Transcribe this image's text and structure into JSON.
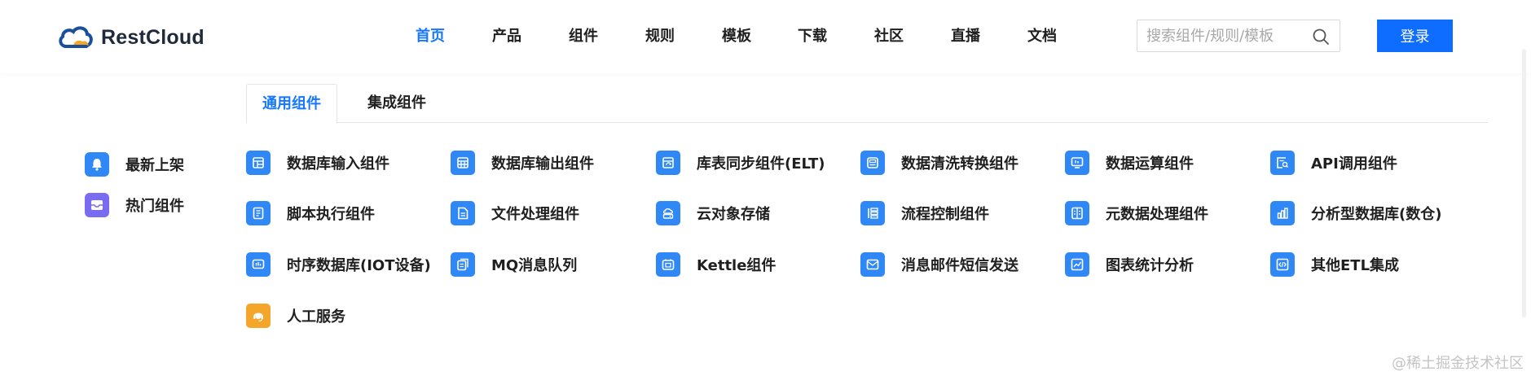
{
  "brand": {
    "name": "RestCloud"
  },
  "nav": {
    "items": [
      {
        "label": "首页",
        "active": true
      },
      {
        "label": "产品"
      },
      {
        "label": "组件"
      },
      {
        "label": "规则"
      },
      {
        "label": "模板"
      },
      {
        "label": "下载"
      },
      {
        "label": "社区"
      },
      {
        "label": "直播"
      },
      {
        "label": "文档"
      }
    ]
  },
  "search": {
    "placeholder": "搜索组件/规则/模板",
    "value": ""
  },
  "login": {
    "label": "登录"
  },
  "tabs": [
    {
      "label": "通用组件",
      "active": true
    },
    {
      "label": "集成组件"
    }
  ],
  "sidebar": {
    "items": [
      {
        "label": "最新上架",
        "icon": "bell-icon",
        "color": "#2f88f5"
      },
      {
        "label": "热门组件",
        "icon": "inbox-icon",
        "color": "#7a6cf0"
      }
    ]
  },
  "components": [
    {
      "label": "数据库输入组件",
      "icon": "table-in-icon"
    },
    {
      "label": "数据库输出组件",
      "icon": "table-out-icon"
    },
    {
      "label": "库表同步组件(ELT)",
      "icon": "sync-table-icon"
    },
    {
      "label": "数据清洗转换组件",
      "icon": "clean-icon"
    },
    {
      "label": "数据运算组件",
      "icon": "monitor-icon"
    },
    {
      "label": "API调用组件",
      "icon": "api-search-icon"
    },
    {
      "label": "脚本执行组件",
      "icon": "script-icon"
    },
    {
      "label": "文件处理组件",
      "icon": "file-icon"
    },
    {
      "label": "云对象存储",
      "icon": "cloud-storage-icon"
    },
    {
      "label": "流程控制组件",
      "icon": "flow-icon"
    },
    {
      "label": "元数据处理组件",
      "icon": "metadata-icon"
    },
    {
      "label": "分析型数据库(数仓)",
      "icon": "bar-chart-icon"
    },
    {
      "label": "时序数据库(IOT设备)",
      "icon": "timeseries-icon"
    },
    {
      "label": "MQ消息队列",
      "icon": "queue-icon"
    },
    {
      "label": "Kettle组件",
      "icon": "kettle-icon"
    },
    {
      "label": "消息邮件短信发送",
      "icon": "mail-icon"
    },
    {
      "label": "图表统计分析",
      "icon": "line-chart-icon"
    },
    {
      "label": "其他ETL集成",
      "icon": "code-icon"
    },
    {
      "label": "人工服务",
      "icon": "support-icon",
      "color": "#f4a62a"
    }
  ],
  "watermark": "@稀土掘金技术社区",
  "colors": {
    "accent": "#1677ff",
    "button": "#0e6dff",
    "icon_blue": "#2f88f5",
    "icon_orange": "#f4a62a",
    "icon_purple": "#7a6cf0"
  }
}
